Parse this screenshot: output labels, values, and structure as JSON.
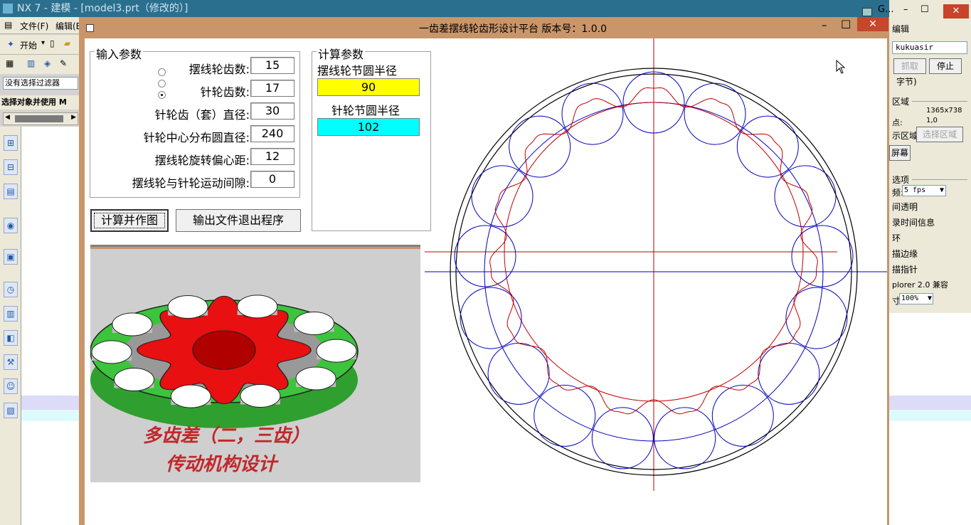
{
  "nx": {
    "window_title": "NX 7 - 建模 - [model3.prt（修改的）]",
    "menu_file": "文件(F)",
    "menu_edit": "编辑(E",
    "start_label": "开始",
    "filter_value": "没有选择过滤器",
    "hint": "选择对象并使用 M"
  },
  "recorder": {
    "app_label": "G...",
    "edit_label": "编辑",
    "input_value": "kukuasir",
    "grab_button": "抓取",
    "stop_button": "停止",
    "bytes_label": "字节)",
    "region_label": "区域",
    "size_value": "1365x738",
    "point_label": "点:",
    "point_value": "1,0",
    "show_region_label": "示区域",
    "select_region_button": "选择区域",
    "screen_button": "屏幕",
    "options_label": "选项",
    "fps_prefix": "频:",
    "fps_value": "5 fps",
    "transparent_label": "间透明",
    "time_info_label": "录时间信息",
    "item_label": "环",
    "edge_label": "描边缘",
    "pointer_label": "描指针",
    "compat_label": "plorer 2.0 兼容",
    "zoom_prefix": "寸",
    "zoom_value": "100%"
  },
  "dialog": {
    "title": "一齿差摆线轮齿形设计平台  版本号：1.0.0",
    "input_group": {
      "title": "输入参数",
      "fields": [
        {
          "label": "摆线轮齿数:",
          "value": "15"
        },
        {
          "label": "针轮齿数:",
          "value": "17"
        },
        {
          "label": "针轮齿（套）直径:",
          "value": "30"
        },
        {
          "label": "针轮中心分布圆直径:",
          "value": "240"
        },
        {
          "label": "摆线轮旋转偏心距:",
          "value": "12"
        },
        {
          "label": "摆线轮与针轮运动间隙:",
          "value": "0"
        }
      ]
    },
    "calc_group": {
      "title": "计算参数",
      "cycloid_label": "摆线轮节圆半径",
      "cycloid_value": "90",
      "pin_label": "针轮节圆半径",
      "pin_value": "102"
    },
    "buttons": {
      "calc": "计算并作图",
      "export": "输出文件退出程序"
    },
    "picture": {
      "caption_line1": "多齿差（二，三齿）",
      "caption_line2": "传动机构设计"
    },
    "colors": {
      "cycloid_value_bg": "#ffff00",
      "pin_value_bg": "#00ffff",
      "cycloid_stroke": "#c00000",
      "pin_stroke": "#0000c0"
    },
    "drawing": {
      "pin_count": 17,
      "cycloid_teeth": 15
    }
  }
}
